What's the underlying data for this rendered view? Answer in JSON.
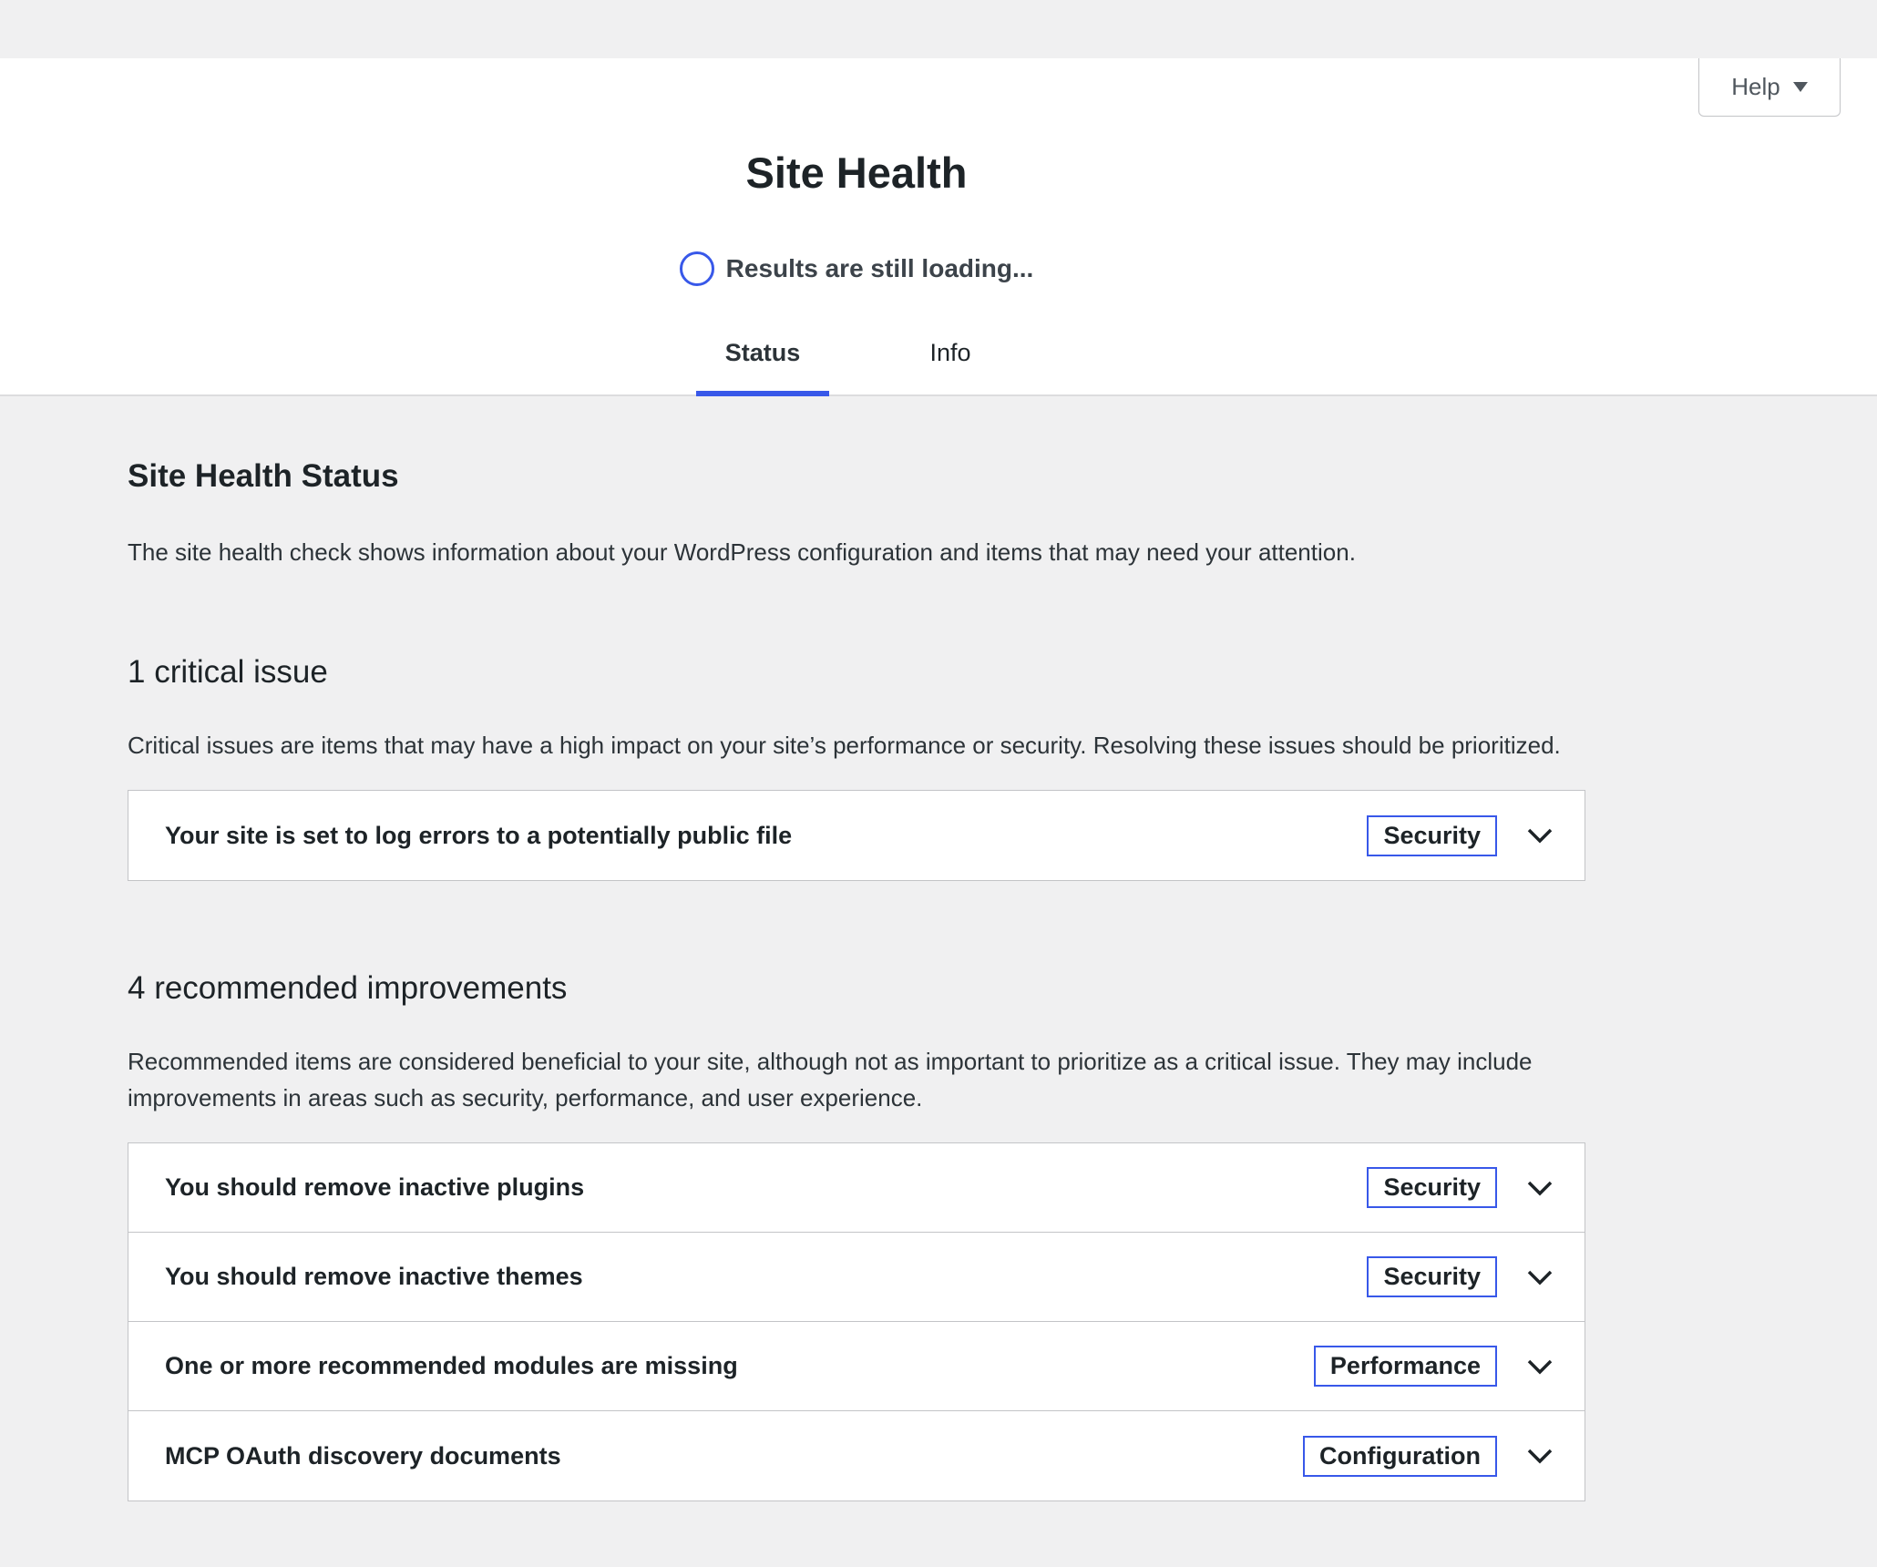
{
  "header": {
    "help_label": "Help",
    "title": "Site Health",
    "loading_text": "Results are still loading...",
    "tabs": [
      {
        "label": "Status",
        "active": true
      },
      {
        "label": "Info",
        "active": false
      }
    ]
  },
  "main": {
    "section_title": "Site Health Status",
    "section_desc": "The site health check shows information about your WordPress configuration and items that may need your attention.",
    "critical": {
      "title": "1 critical issue",
      "desc": "Critical issues are items that may have a high impact on your site’s performance or security. Resolving these issues should be prioritized.",
      "items": [
        {
          "label": "Your site is set to log errors to a potentially public file",
          "badge": "Security"
        }
      ]
    },
    "recommended": {
      "title": "4 recommended improvements",
      "desc": "Recommended items are considered beneficial to your site, although not as important to prioritize as a critical issue. They may include improvements in areas such as security, performance, and user experience.",
      "items": [
        {
          "label": "You should remove inactive plugins",
          "badge": "Security"
        },
        {
          "label": "You should remove inactive themes",
          "badge": "Security"
        },
        {
          "label": "One or more recommended modules are missing",
          "badge": "Performance"
        },
        {
          "label": "MCP OAuth discovery documents",
          "badge": "Configuration"
        }
      ]
    }
  },
  "colors": {
    "accent": "#3858e9",
    "background": "#f0f0f1",
    "panel": "#ffffff",
    "border": "#c3c4c7"
  },
  "icons": {
    "loading": "loading-circle-icon",
    "help_caret": "caret-down-icon",
    "expand": "chevron-down-icon"
  }
}
